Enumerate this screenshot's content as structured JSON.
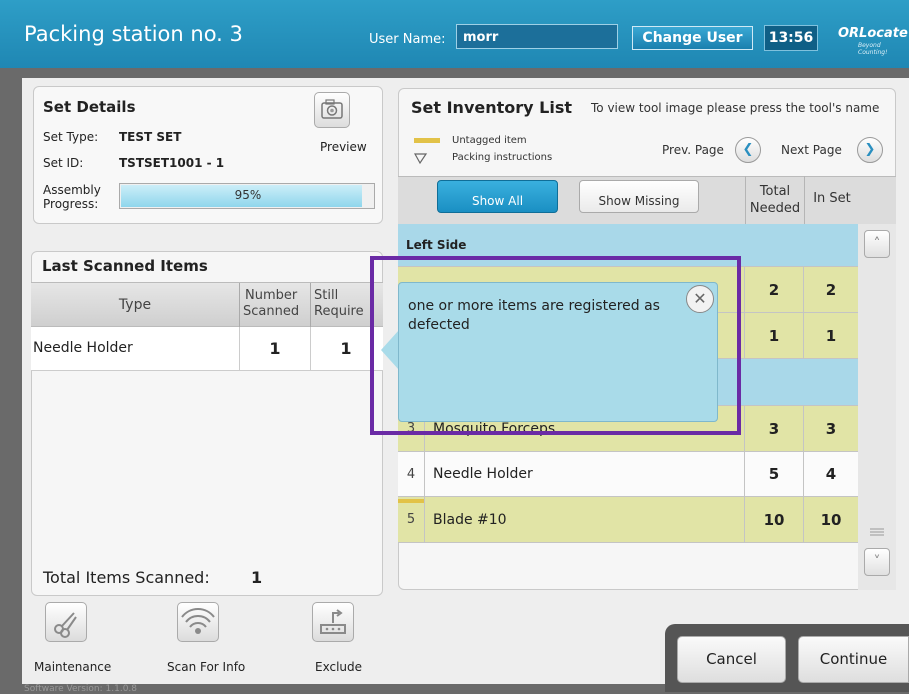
{
  "header": {
    "title": "Packing station no. 3",
    "user_name_label": "User Name:",
    "user_name": "morr",
    "change_user": "Change User",
    "clock": "13:56",
    "logo": "ORLocate",
    "logo_tagline": "Beyond Counting!"
  },
  "set_details": {
    "heading": "Set Details",
    "set_type_label": "Set Type:",
    "set_type": "TEST SET",
    "set_id_label": "Set ID:",
    "set_id": "TSTSET1001 - 1",
    "assembly_label_1": "Assembly",
    "assembly_label_2": "Progress:",
    "progress_text": "95%",
    "progress_value": 0.95,
    "preview_label": "Preview"
  },
  "last_scanned": {
    "heading": "Last Scanned Items",
    "col_type": "Type",
    "col_number_1": "Number",
    "col_number_2": "Scanned",
    "col_still_1": "Still",
    "col_still_2": "Require",
    "rows": [
      {
        "type": "Needle Holder",
        "scanned": "1",
        "still": "1"
      }
    ],
    "total_label": "Total Items Scanned:",
    "total_value": "1"
  },
  "inventory": {
    "heading": "Set Inventory List",
    "hint": "To view tool image please press the tool's name",
    "legend_untagged": "Untagged item",
    "legend_packing": "Packing instructions",
    "prev_page": "Prev. Page",
    "next_page": "Next Page",
    "show_all": "Show All",
    "show_missing": "Show Missing",
    "col_total_1": "Total",
    "col_total_2": "Needed",
    "col_in_set": "In Set",
    "section_left": "Left Side",
    "rows": [
      {
        "idx": "",
        "name": "",
        "total": "2",
        "in_set": "2"
      },
      {
        "idx": "",
        "name": "",
        "total": "1",
        "in_set": "1"
      },
      {
        "idx": "3",
        "name": "Mosquito Forceps",
        "total": "3",
        "in_set": "3"
      },
      {
        "idx": "4",
        "name": "Needle Holder",
        "total": "5",
        "in_set": "4"
      },
      {
        "idx": "5",
        "name": "Blade #10",
        "total": "10",
        "in_set": "10"
      }
    ]
  },
  "popup": {
    "message": "one  or more items are registered as defected"
  },
  "toolbar": {
    "maintenance": "Maintenance",
    "scan_for_info": "Scan For Info",
    "exclude": "Exclude"
  },
  "actions": {
    "cancel": "Cancel",
    "continue": "Continue"
  },
  "footer": {
    "version": "Software Version: 1.1.0.8"
  },
  "colors": {
    "header_blue": "#1f87b3",
    "row_yellow": "#e1e4a6",
    "row_blue": "#a9d8e9",
    "highlight_purple": "#6a2aa5"
  }
}
